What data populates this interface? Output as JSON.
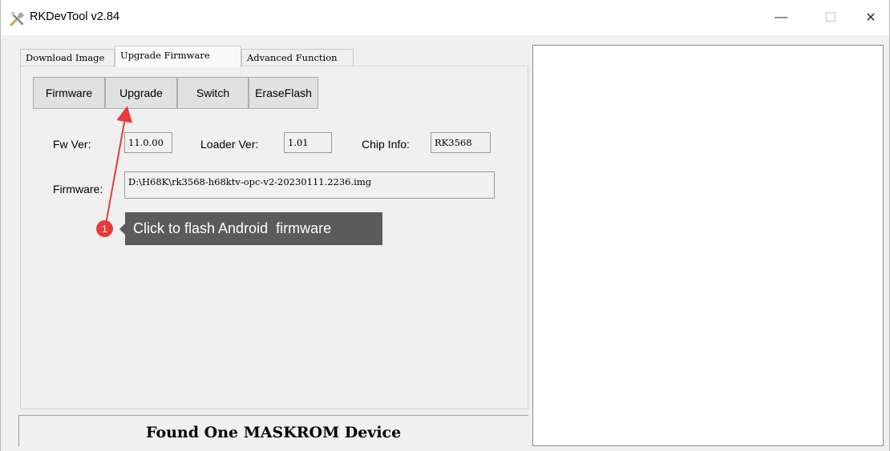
{
  "window": {
    "title": "RKDevTool v2.84",
    "controls": {
      "minimize": "—",
      "maximize": "☐",
      "close": "✕"
    }
  },
  "tabs": [
    {
      "label": "Download Image",
      "active": false
    },
    {
      "label": "Upgrade Firmware",
      "active": true
    },
    {
      "label": "Advanced Function",
      "active": false
    }
  ],
  "toolbar": {
    "firmware_label": "Firmware",
    "upgrade_label": "Upgrade",
    "switch_label": "Switch",
    "eraseflash_label": "EraseFlash"
  },
  "info": {
    "fw_ver_label": "Fw Ver:",
    "fw_ver_value": "11.0.00",
    "loader_ver_label": "Loader Ver:",
    "loader_ver_value": "1.01",
    "chip_info_label": "Chip Info:",
    "chip_info_value": "RK3568",
    "firmware_label": "Firmware:",
    "firmware_path": "D:\\H68K\\rk3568-h68ktv-opc-v2-20230111.2236.img"
  },
  "annotation": {
    "step_number": "1",
    "tooltip_text": "Click to flash Android  firmware",
    "color": "#e83a3a"
  },
  "status": {
    "message": "Found One MASKROM Device"
  },
  "icons": {
    "app": "rkdevtool-app-icon"
  }
}
